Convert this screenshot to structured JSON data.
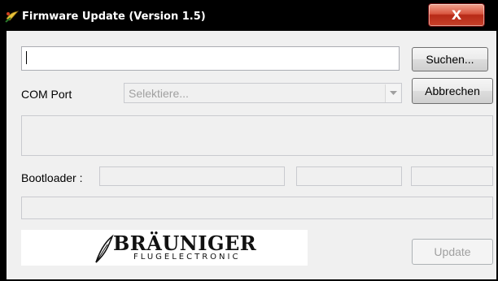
{
  "window": {
    "title": "Firmware Update (Version 1.5)",
    "close_symbol": "X"
  },
  "search": {
    "value": "",
    "button_label": "Suchen..."
  },
  "com_port": {
    "label": "COM Port",
    "placeholder": "Selektiere...",
    "cancel_label": "Abbrechen"
  },
  "bootloader": {
    "label": "Bootloader :"
  },
  "logo": {
    "name": "BRÄUNIGER",
    "tagline": "FLUGELECTRONIC"
  },
  "update": {
    "button_label": "Update"
  },
  "colors": {
    "close_button": "#c8412a",
    "titlebar": "#000000",
    "client": "#f0f0f0"
  }
}
